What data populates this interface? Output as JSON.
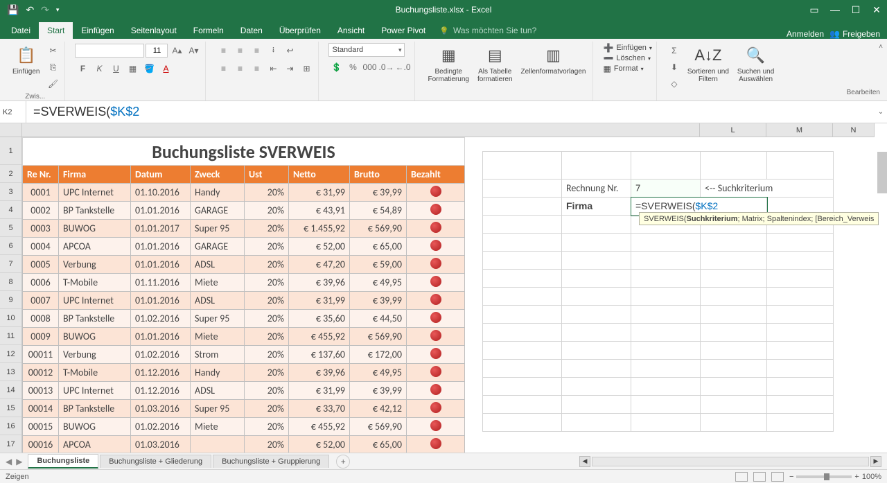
{
  "titlebar": {
    "title": "Buchungsliste.xlsx - Excel"
  },
  "tabs": {
    "file": "Datei",
    "home": "Start",
    "insert": "Einfügen",
    "layout": "Seitenlayout",
    "formulas": "Formeln",
    "data": "Daten",
    "review": "Überprüfen",
    "view": "Ansicht",
    "powerpivot": "Power Pivot",
    "tell": "Was möchten Sie tun?",
    "signin": "Anmelden",
    "share": "Freigeben"
  },
  "ribbon": {
    "clipboard": {
      "paste": "Einfügen",
      "label": "Zwis..."
    },
    "font": {
      "size": "11"
    },
    "number": {
      "format": "Standard"
    },
    "styles": {
      "conditional": "Bedingte\nFormatierung",
      "table": "Als Tabelle\nformatieren",
      "cellstyles": "Zellenformatvorlagen"
    },
    "cells": {
      "insert": "Einfügen",
      "delete": "Löschen",
      "format": "Format"
    },
    "editing": {
      "sortfilter": "Sortieren und\nFiltern",
      "findselect": "Suchen und\nAuswählen",
      "label": "Bearbeiten"
    }
  },
  "formula_bar": {
    "namebox": "K2",
    "formula": "=SVERWEIS($K$2",
    "ref": "$K$2"
  },
  "col_headers": {
    "L": "L",
    "M": "M",
    "N": "N"
  },
  "main": {
    "title": "Buchungsliste SVERWEIS",
    "headers": {
      "re": "Re Nr.",
      "firma": "Firma",
      "datum": "Datum",
      "zweck": "Zweck",
      "ust": "Ust",
      "netto": "Netto",
      "brutto": "Brutto",
      "bezahlt": "Bezahlt"
    },
    "rows": [
      {
        "re": "0001",
        "firma": "UPC Internet",
        "datum": "01.10.2016",
        "zweck": "Handy",
        "ust": "20%",
        "netto": "€      31,99",
        "brutto": "€ 39,99"
      },
      {
        "re": "0002",
        "firma": "BP Tankstelle",
        "datum": "01.01.2016",
        "zweck": "GARAGE",
        "ust": "20%",
        "netto": "€      43,91",
        "brutto": "€ 54,89"
      },
      {
        "re": "0003",
        "firma": "BUWOG",
        "datum": "01.01.2017",
        "zweck": "Super 95",
        "ust": "20%",
        "netto": "€ 1.455,92",
        "brutto": "€ 569,90"
      },
      {
        "re": "0004",
        "firma": "APCOA",
        "datum": "01.01.2016",
        "zweck": "GARAGE",
        "ust": "20%",
        "netto": "€      52,00",
        "brutto": "€ 65,00"
      },
      {
        "re": "0005",
        "firma": "Verbung",
        "datum": "01.01.2016",
        "zweck": "ADSL",
        "ust": "20%",
        "netto": "€      47,20",
        "brutto": "€ 59,00"
      },
      {
        "re": "0006",
        "firma": "T-Mobile",
        "datum": "01.11.2016",
        "zweck": "Miete",
        "ust": "20%",
        "netto": "€      39,96",
        "brutto": "€ 49,95"
      },
      {
        "re": "0007",
        "firma": "UPC Internet",
        "datum": "01.01.2016",
        "zweck": "ADSL",
        "ust": "20%",
        "netto": "€      31,99",
        "brutto": "€ 39,99"
      },
      {
        "re": "0008",
        "firma": "BP Tankstelle",
        "datum": "01.02.2016",
        "zweck": "Super 95",
        "ust": "20%",
        "netto": "€      35,60",
        "brutto": "€ 44,50"
      },
      {
        "re": "0009",
        "firma": "BUWOG",
        "datum": "01.01.2016",
        "zweck": "Miete",
        "ust": "20%",
        "netto": "€    455,92",
        "brutto": "€ 569,90"
      },
      {
        "re": "00011",
        "firma": "Verbung",
        "datum": "01.02.2016",
        "zweck": "Strom",
        "ust": "20%",
        "netto": "€    137,60",
        "brutto": "€ 172,00"
      },
      {
        "re": "00012",
        "firma": "T-Mobile",
        "datum": "01.12.2016",
        "zweck": "Handy",
        "ust": "20%",
        "netto": "€      39,96",
        "brutto": "€ 49,95"
      },
      {
        "re": "00013",
        "firma": "UPC Internet",
        "datum": "01.12.2016",
        "zweck": "ADSL",
        "ust": "20%",
        "netto": "€      31,99",
        "brutto": "€ 39,99"
      },
      {
        "re": "00014",
        "firma": "BP Tankstelle",
        "datum": "01.03.2016",
        "zweck": "Super 95",
        "ust": "20%",
        "netto": "€      33,70",
        "brutto": "€ 42,12"
      },
      {
        "re": "00015",
        "firma": "BUWOG",
        "datum": "01.02.2016",
        "zweck": "Miete",
        "ust": "20%",
        "netto": "€    455,92",
        "brutto": "€ 569,90"
      },
      {
        "re": "00016",
        "firma": "APCOA",
        "datum": "01.03.2016",
        "zweck": "",
        "ust": "20%",
        "netto": "€      52,00",
        "brutto": "€ 65,00"
      }
    ]
  },
  "side": {
    "rechnung_label": "Rechnung Nr.",
    "rechnung_val": "7",
    "suchkrit": "<-- Suchkriterium",
    "firma_label": "Firma",
    "firma_formula": "=SVERWEIS($K$2",
    "tooltip_fn": "SVERWEIS(",
    "tooltip_b": "Suchkriterium",
    "tooltip_rest": "; Matrix; Spaltenindex; [Bereich_Verweis"
  },
  "sheets": {
    "s1": "Buchungsliste",
    "s2": "Buchungsliste + Gliederung",
    "s3": "Buchungsliste + Gruppierung"
  },
  "status": {
    "mode": "Zeigen",
    "zoom": "100%"
  }
}
